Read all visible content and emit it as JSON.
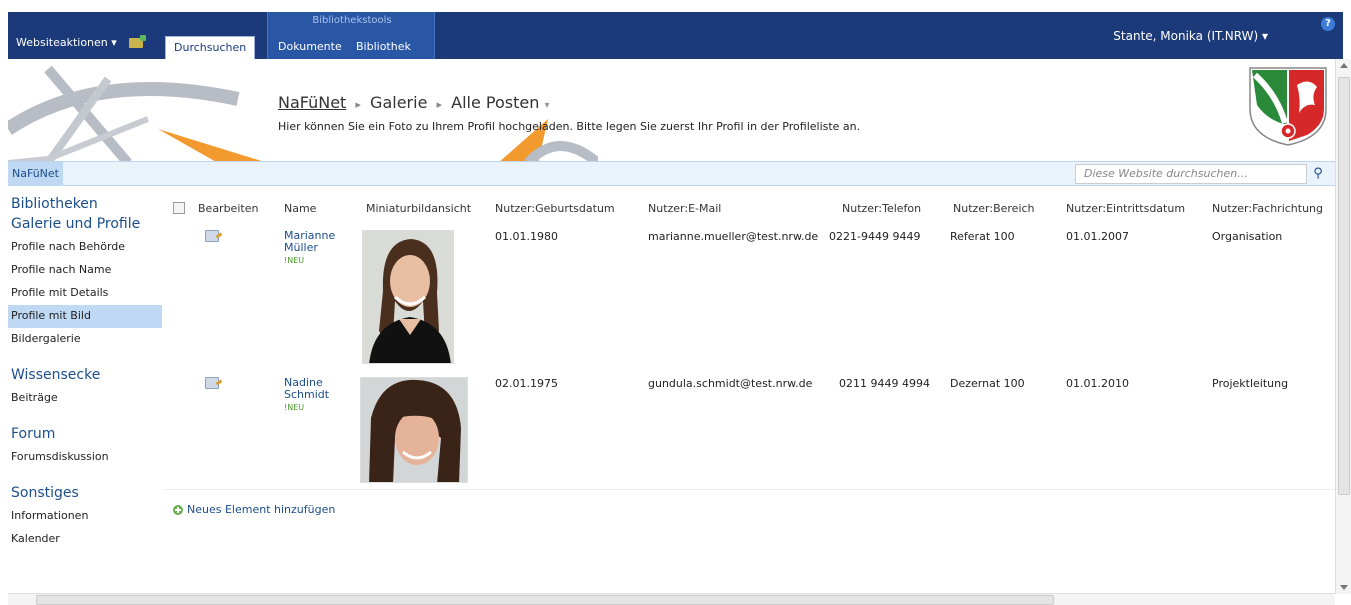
{
  "ribbon": {
    "site_actions": "Websiteaktionen ▾",
    "browse_tab": "Durchsuchen",
    "context_group": "Bibliothekstools",
    "documents_tab": "Dokumente",
    "library_tab": "Bibliothek",
    "user": "Stante, Monika (IT.NRW) ▾",
    "help": "?"
  },
  "header": {
    "crumb_site": "NaFüNet",
    "crumb_list": "Galerie",
    "crumb_view": "Alle Posten",
    "crumb_sep": "▸",
    "view_chevron": "▾",
    "subtitle": "Hier können Sie ein Foto zu Ihrem Profil hochgeladen. Bitte legen Sie zuerst Ihr Profil in der Profileliste an."
  },
  "topnav": {
    "home": "NaFüNet",
    "search_placeholder": "Diese Website durchsuchen..."
  },
  "quicklaunch": {
    "sections": [
      {
        "heading": "Bibliotheken",
        "items": []
      },
      {
        "heading": "Galerie und Profile",
        "items": [
          "Profile nach Behörde",
          "Profile nach Name",
          "Profile mit Details",
          "Profile mit Bild",
          "Bildergalerie"
        ]
      },
      {
        "heading": "Wissensecke",
        "items": [
          "Beiträge"
        ]
      },
      {
        "heading": "Forum",
        "items": [
          "Forumsdiskussion"
        ]
      },
      {
        "heading": "Sonstiges",
        "items": [
          "Informationen",
          "Kalender"
        ]
      }
    ],
    "selected": "Profile mit Bild"
  },
  "list": {
    "columns": [
      "Bearbeiten",
      "Name",
      "Miniaturbildansicht",
      "Nutzer:Geburtsdatum",
      "Nutzer:E-Mail",
      "Nutzer:Telefon",
      "Nutzer:Bereich",
      "Nutzer:Eintrittsdatum",
      "Nutzer:Fachrichtung"
    ],
    "rows": [
      {
        "name_first": "Marianne",
        "name_last": "Müller",
        "badge": "NEU",
        "birthdate": "01.01.1980",
        "email": "marianne.mueller@test.nrw.de",
        "phone": "0221-9449 9449",
        "area": "Referat 100",
        "entry_date": "01.01.2007",
        "field": "Organisation"
      },
      {
        "name_first": "Nadine",
        "name_last": "Schmidt",
        "badge": "NEU",
        "birthdate": "02.01.1975",
        "email": "gundula.schmidt@test.nrw.de",
        "phone": "0211 9449 4994",
        "area": "Dezernat 100",
        "entry_date": "01.01.2010",
        "field": "Projektleitung"
      }
    ],
    "add_new": "Neues Element hinzufügen"
  },
  "colors": {
    "ribbon": "#1c3a7a",
    "accent": "#1c4e8c",
    "selected": "#bfd8f3"
  }
}
